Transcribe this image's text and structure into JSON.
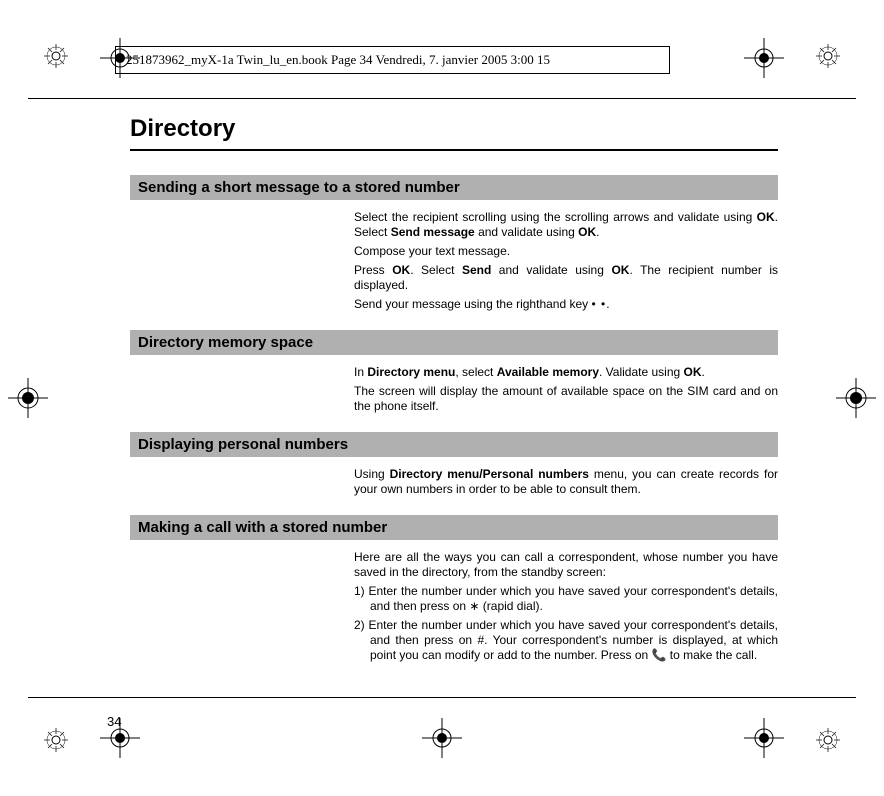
{
  "header": {
    "filepath": "251873962_myX-1a Twin_lu_en.book  Page 34  Vendredi, 7. janvier 2005  3:00 15"
  },
  "page": {
    "title": "Directory",
    "number": "34"
  },
  "sections": [
    {
      "heading": "Sending a short message to a stored number",
      "paras": [
        "Select the recipient scrolling using the scrolling arrows and validate using OK. Select Send message and validate using OK.",
        "Compose your text message.",
        "Press OK. Select Send and validate using OK. The recipient number is displayed.",
        "Send your message using the righthand key • •."
      ]
    },
    {
      "heading": "Directory memory space",
      "paras": [
        "In Directory menu, select Available memory. Validate using OK.",
        "The screen will display the amount of available space on the SIM card and on the phone itself."
      ]
    },
    {
      "heading": "Displaying personal numbers",
      "paras": [
        "Using Directory menu/Personal numbers menu, you can create records for your own numbers in order to be able to consult them."
      ]
    },
    {
      "heading": "Making a call with a stored number",
      "intro": "Here are all the ways you can call a correspondent, whose number you have saved in the directory, from the standby screen:",
      "list": [
        "Enter the number under which you have saved your correspondent's details, and then press on ∗ (rapid dial).",
        "Enter the number under which you have saved your correspondent's details, and then press on #.  Your correspondent's number is displayed, at which point you can modify or add to the number. Press on 📞 to make the call."
      ]
    }
  ],
  "bold_terms": {
    "ok": "OK",
    "send_message": "Send message",
    "send": "Send",
    "directory_menu": "Directory menu",
    "available_memory": "Available memory",
    "personal_numbers": "Directory menu/Personal numbers"
  }
}
